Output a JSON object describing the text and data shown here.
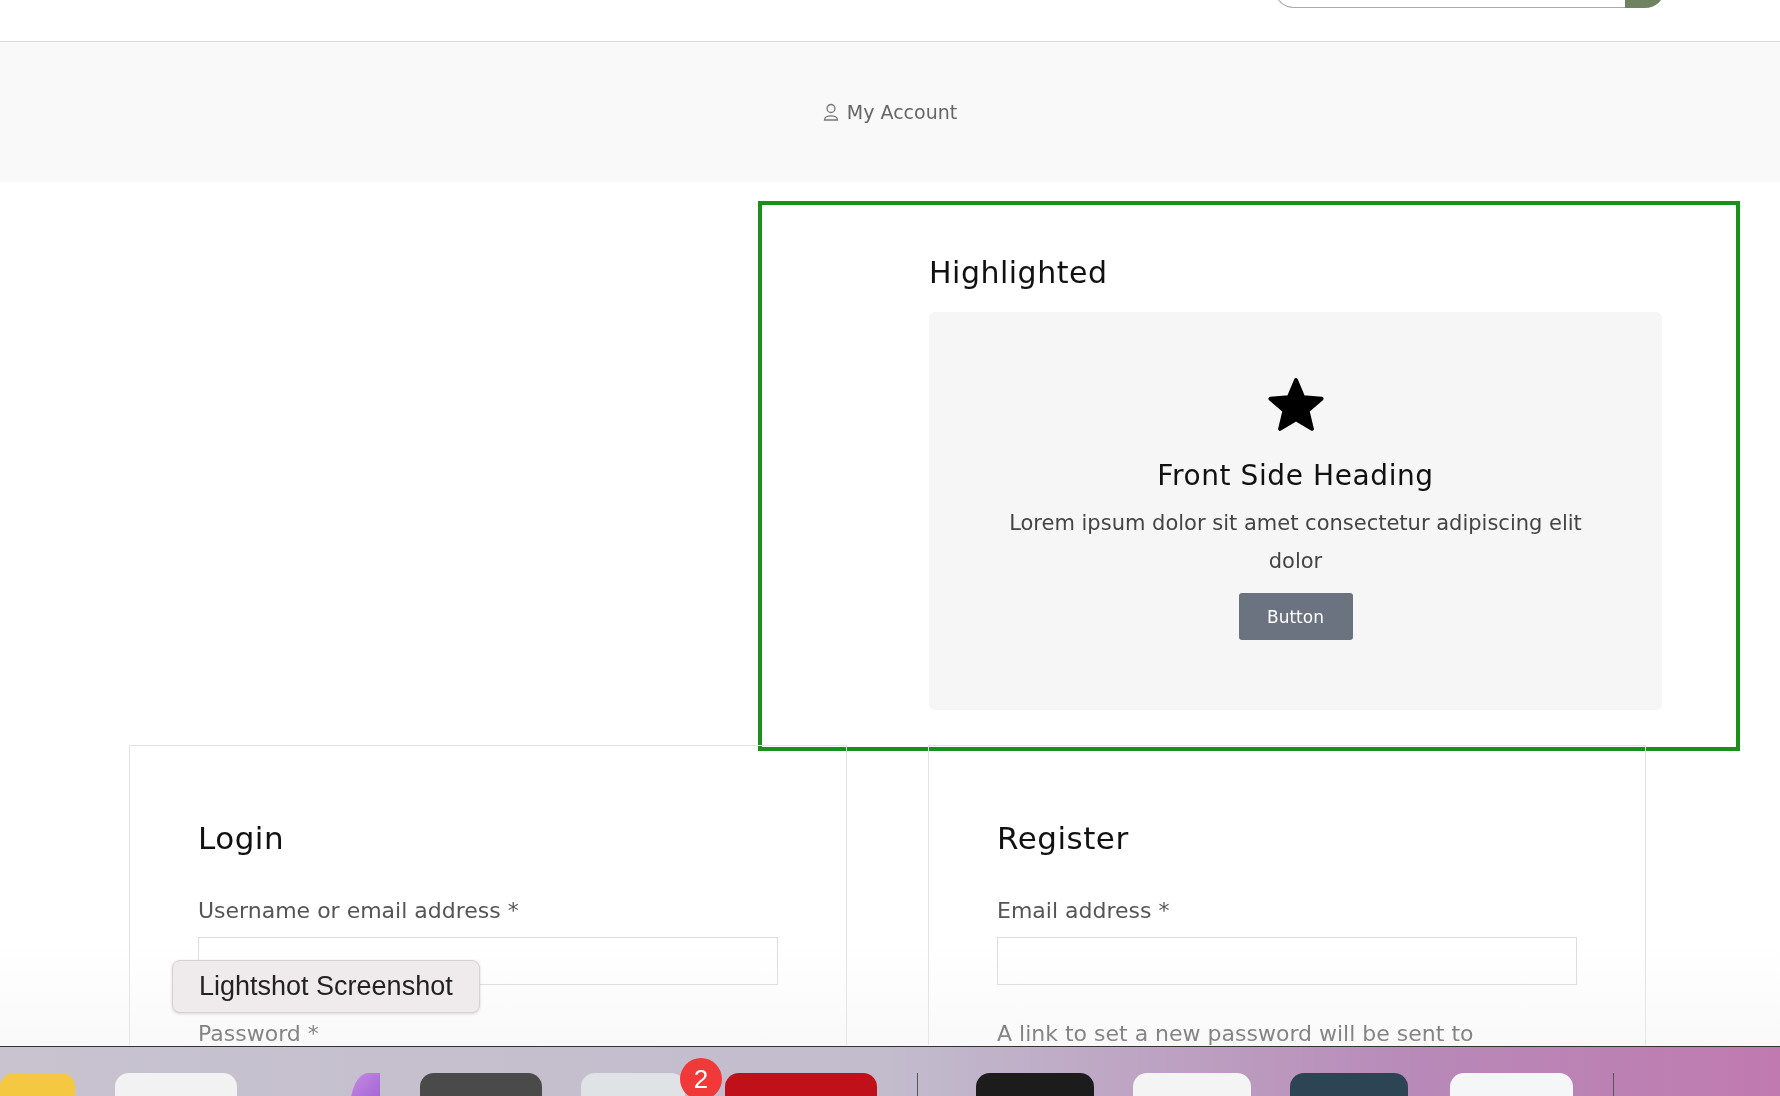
{
  "account_link": {
    "label": "My Account"
  },
  "highlighted": {
    "title": "Highlighted",
    "card": {
      "heading": "Front Side Heading",
      "text": "Lorem ipsum dolor sit amet consectetur adipiscing elit dolor",
      "button": "Button"
    }
  },
  "login": {
    "title": "Login",
    "items": [
      {
        "kind": "field",
        "label": "Username or email address *"
      },
      {
        "kind": "label",
        "label": "Password *"
      }
    ]
  },
  "register": {
    "title": "Register",
    "items": [
      {
        "kind": "field",
        "label": "Email address *"
      },
      {
        "kind": "note",
        "label": "A link to set a new password will be sent to"
      }
    ]
  },
  "tooltip": {
    "text": "Lightshot Screenshot"
  },
  "dock": {
    "badge": "2"
  }
}
